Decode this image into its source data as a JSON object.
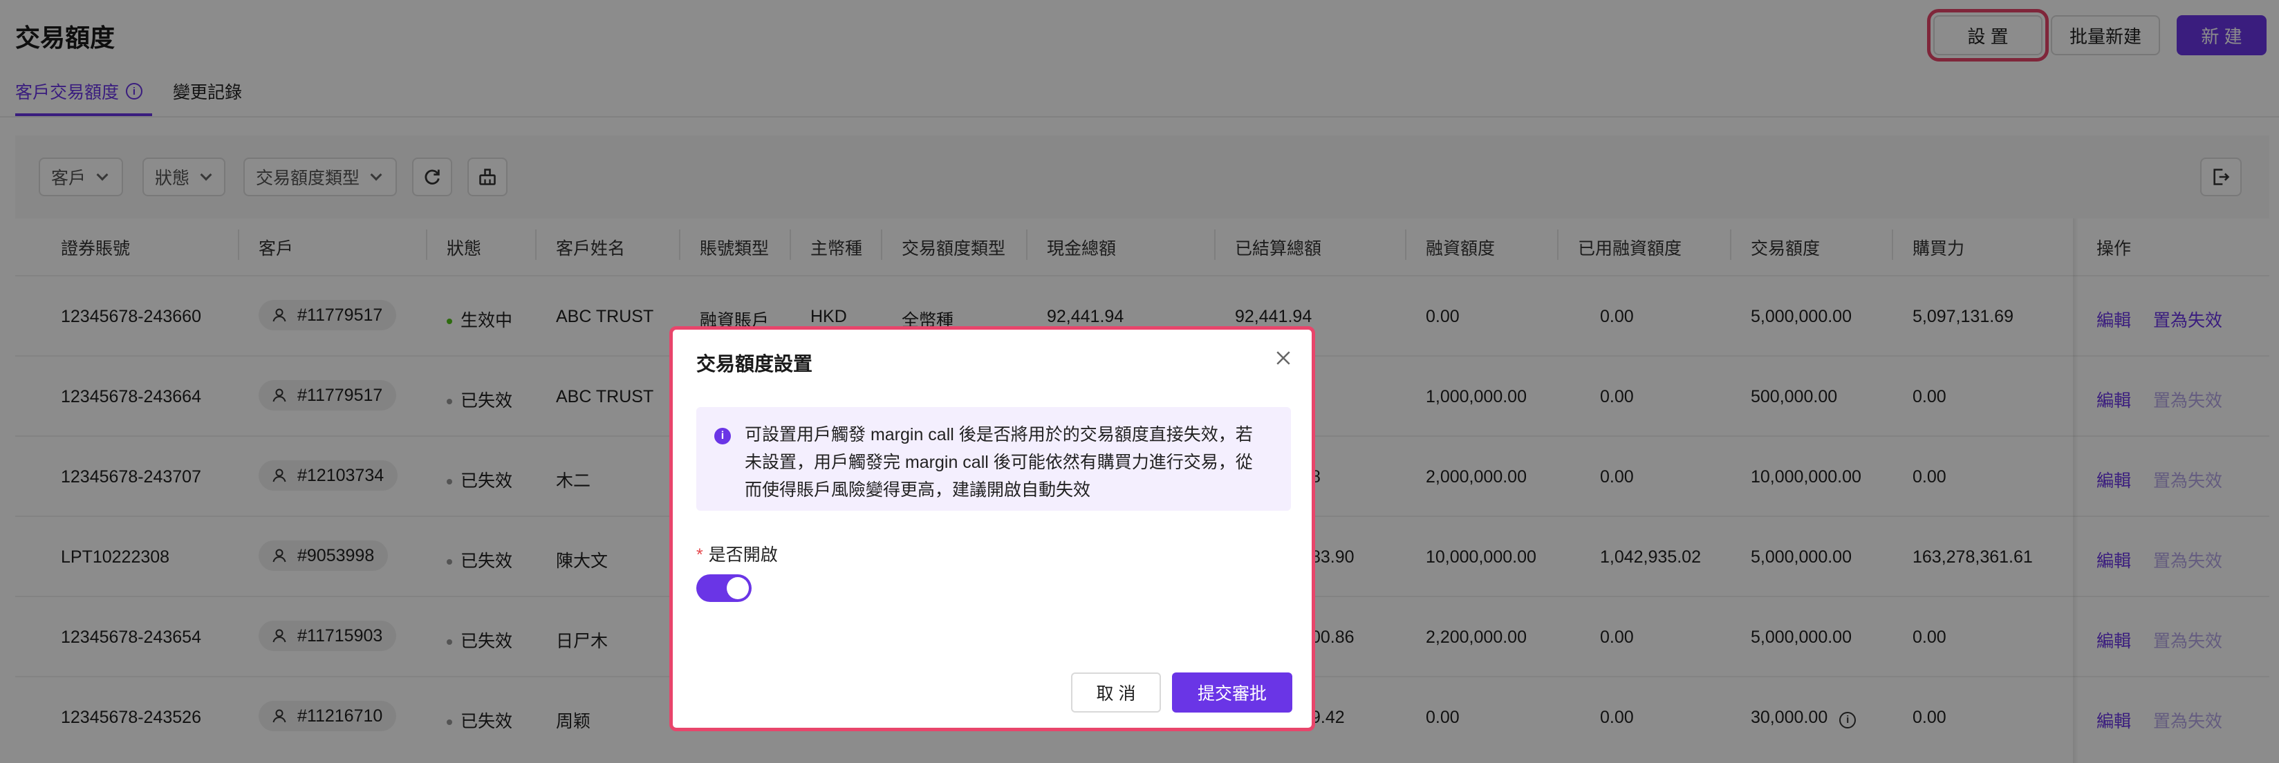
{
  "header": {
    "title": "交易額度",
    "settings_label": "設 置",
    "batch_label": "批量新建",
    "new_label": "新 建"
  },
  "tabs": [
    {
      "label": "客戶交易額度"
    },
    {
      "label": "變更記錄"
    }
  ],
  "filters": {
    "customer": "客戶",
    "status": "狀態",
    "quota_type": "交易額度類型"
  },
  "table": {
    "columns": [
      "證券賬號",
      "客戶",
      "狀態",
      "客戶姓名",
      "賬號類型",
      "主幣種",
      "交易額度類型",
      "現金總額",
      "已結算總額",
      "融資額度",
      "已用融資額度",
      "交易額度",
      "購買力",
      "操作"
    ],
    "rows": [
      {
        "account": "12345678-243660",
        "customer": "#11779517",
        "status": "生效中",
        "name": "ABC TRUST",
        "acct_type": "融資賬戶",
        "currency": "HKD",
        "quota_type": "全幣種",
        "cash": "92,441.94",
        "settled": "92,441.94",
        "margin": "0.00",
        "used_margin": "0.00",
        "quota": "5,000,000.00",
        "buying_power": "5,097,131.69",
        "edit": "編輯",
        "invalidate": "置為失效"
      },
      {
        "account": "12345678-243664",
        "customer": "#11779517",
        "status": "已失效",
        "name": "ABC TRUST",
        "margin": "1,000,000.00",
        "used_margin": "0.00",
        "quota": "500,000.00",
        "buying_power": "0.00",
        "edit": "編輯",
        "invalidate": "置為失效"
      },
      {
        "account": "12345678-243707",
        "customer": "#12103734",
        "status": "已失效",
        "name": "木二",
        "settled_tail": "8",
        "margin": "2,000,000.00",
        "used_margin": "0.00",
        "quota": "10,000,000.00",
        "buying_power": "0.00",
        "edit": "編輯",
        "invalidate": "置為失效"
      },
      {
        "account": "LPT10222308",
        "customer": "#9053998",
        "status": "已失效",
        "name": "陳大文",
        "settled_tail": "83.90",
        "margin": "10,000,000.00",
        "used_margin": "1,042,935.02",
        "quota": "5,000,000.00",
        "buying_power": "163,278,361.61",
        "edit": "編輯",
        "invalidate": "置為失效"
      },
      {
        "account": "12345678-243654",
        "customer": "#11715903",
        "status": "已失效",
        "name": "日尸木",
        "settled_tail": "00.86",
        "margin": "2,200,000.00",
        "used_margin": "0.00",
        "quota": "5,000,000.00",
        "buying_power": "0.00",
        "edit": "編輯",
        "invalidate": "置為失效"
      },
      {
        "account": "12345678-243526",
        "customer": "#11216710",
        "status": "已失效",
        "name": "周颖",
        "settled_tail": "9.42",
        "margin": "0.00",
        "used_margin": "0.00",
        "quota": "30,000.00",
        "buying_power": "0.00",
        "edit": "編輯",
        "invalidate": "置為失效"
      }
    ]
  },
  "modal": {
    "title": "交易額度設置",
    "alert_lines": [
      "可設置用戶觸發 margin call 後是否將用於的交易額度直接失效，若",
      "未設置，用戶觸發完 margin call 後可能依然有購買力進行交易，從",
      "而使得賬戶風險變得更高，建議開啟自動失效"
    ],
    "field_label": "是否開啟",
    "switch_on": true,
    "cancel_label": "取 消",
    "submit_label": "提交審批"
  },
  "colors": {
    "accent": "#6a35e6",
    "highlight": "#e8456b",
    "active_dot": "#52c41a",
    "inactive_dot": "#999999"
  }
}
